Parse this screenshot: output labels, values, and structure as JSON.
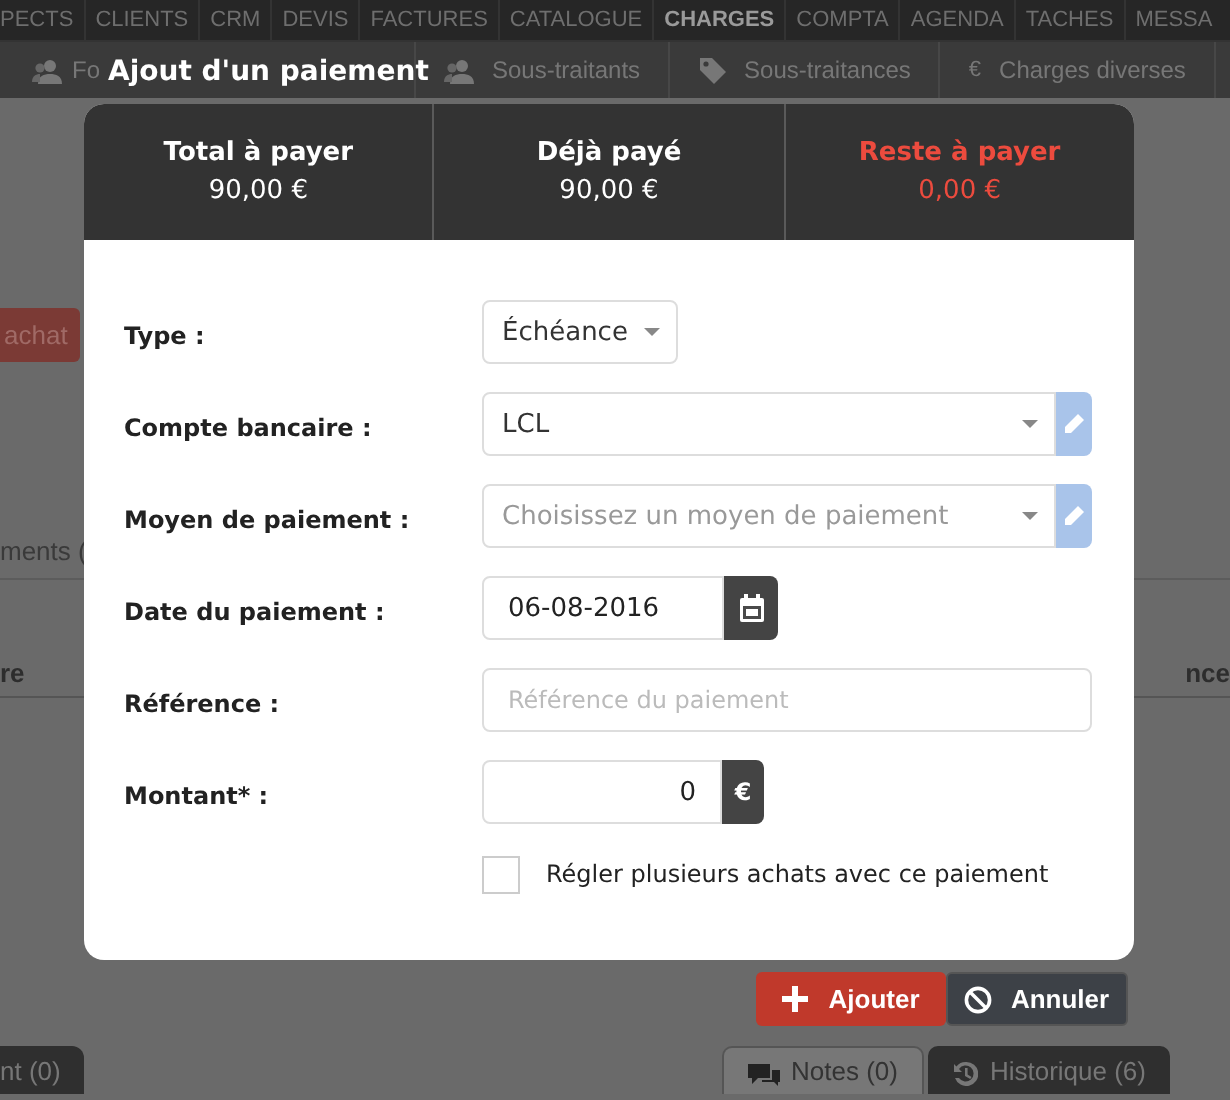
{
  "nav": {
    "items": [
      {
        "label": "PECTS",
        "selected": false
      },
      {
        "label": "CLIENTS",
        "selected": false
      },
      {
        "label": "CRM",
        "selected": false
      },
      {
        "label": "DEVIS",
        "selected": false
      },
      {
        "label": "FACTURES",
        "selected": false
      },
      {
        "label": "CATALOGUE",
        "selected": false
      },
      {
        "label": "CHARGES",
        "selected": true
      },
      {
        "label": "COMPTA",
        "selected": false
      },
      {
        "label": "AGENDA",
        "selected": false
      },
      {
        "label": "TACHES",
        "selected": false
      },
      {
        "label": "MESSA",
        "selected": false
      }
    ]
  },
  "subnav": {
    "items": [
      {
        "label": "Fo",
        "kind": "users"
      },
      {
        "label": "Sous-traitants",
        "kind": "users"
      },
      {
        "label": "Sous-traitances",
        "kind": "tag"
      },
      {
        "label": "Charges diverses",
        "kind": "glyph",
        "icon_text": "€"
      }
    ]
  },
  "background": {
    "button": "achat",
    "section_label": "ments (",
    "table_headers": [
      "re",
      "nce"
    ],
    "tabs": [
      {
        "label": "nt (0)",
        "selected": false
      },
      {
        "label": "Notes (0)",
        "selected": true,
        "kind": "chat"
      },
      {
        "label": "Historique (6)",
        "selected": false,
        "kind": "history"
      }
    ]
  },
  "dialog": {
    "title": "Ajout d'un paiement",
    "summary": [
      {
        "label": "Total à payer",
        "amount": "90,00 €",
        "alert": false
      },
      {
        "label": "Déjà payé",
        "amount": "90,00 €",
        "alert": false
      },
      {
        "label": "Reste à payer",
        "amount": "0,00 €",
        "alert": true
      }
    ],
    "fields": [
      {
        "kind": "select",
        "label": "Type :",
        "value": "Échéance"
      },
      {
        "kind": "select",
        "label": "Compte bancaire :",
        "value": "LCL",
        "editable": true
      },
      {
        "kind": "select",
        "label": "Moyen de paiement :",
        "placeholder": "Choisissez un moyen de paiement",
        "editable": true
      },
      {
        "kind": "date",
        "label": "Date du paiement :",
        "value": "06-08-2016"
      },
      {
        "kind": "text",
        "label": "Référence :",
        "placeholder": "Référence du paiement"
      },
      {
        "kind": "amount",
        "label": "Montant* :",
        "value": "0",
        "addon": "€"
      },
      {
        "kind": "checkbox",
        "label": "Régler plusieurs achats avec ce paiement",
        "checked": false
      }
    ],
    "buttons": [
      {
        "label": "Ajouter",
        "kind": "primary"
      },
      {
        "label": "Annuler",
        "kind": "cancel"
      }
    ]
  }
}
